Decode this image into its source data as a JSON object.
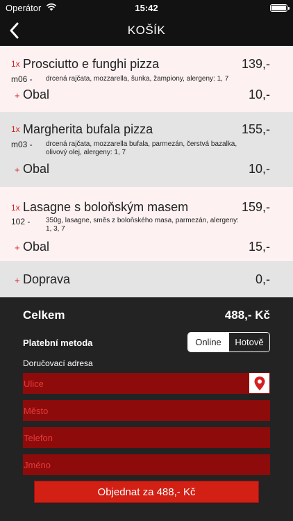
{
  "status_bar": {
    "carrier": "Operátor",
    "time": "15:42",
    "battery_level": 1.0
  },
  "nav": {
    "title": "KOŠÍK"
  },
  "cart": {
    "items": [
      {
        "qty": "1x",
        "name": "Prosciutto e funghi pizza",
        "price": "139,-",
        "code": "m06 -",
        "description": "drcená rajčata, mozzarella, šunka, žampiony, alergeny: 1, 7",
        "extra_prefix": "+",
        "extra_name": "Obal",
        "extra_price": "10,-"
      },
      {
        "qty": "1x",
        "name": "Margherita bufala pizza",
        "price": "155,-",
        "code": "m03 -",
        "description": "drcená rajčata, mozzarella bufala, parmezán, čerstvá bazalka, olivový olej, alergeny: 1, 7",
        "extra_prefix": "+",
        "extra_name": "Obal",
        "extra_price": "10,-"
      },
      {
        "qty": "1x",
        "name": "Lasagne s boloňským masem",
        "price": "159,-",
        "code": "102 -",
        "description": "350g, lasagne, směs z boloňského masa, parmezán, alergeny: 1, 3, 7",
        "extra_prefix": "+",
        "extra_name": "Obal",
        "extra_price": "15,-"
      }
    ],
    "delivery": {
      "prefix": "+",
      "label": "Doprava",
      "price": "0,-"
    }
  },
  "checkout": {
    "total_label": "Celkem",
    "total_value": "488,- Kč",
    "payment_label": "Platební metoda",
    "payment_options": [
      "Online",
      "Hotově"
    ],
    "payment_selected": "Online",
    "address_label": "Doručovací adresa",
    "fields": {
      "street_placeholder": "Ulice",
      "city_placeholder": "Město",
      "phone_placeholder": "Telefon",
      "name_placeholder": "Jméno"
    },
    "order_button": "Objednat za 488,- Kč"
  },
  "colors": {
    "accent": "#d42020",
    "field_bg": "#8e0b0b",
    "button_bg": "#d22015",
    "panel_bg": "#232323",
    "bar_bg": "#121212"
  },
  "icons": {
    "back": "chevron-left-icon",
    "wifi": "wifi-icon",
    "battery": "battery-icon",
    "location": "map-pin-icon"
  }
}
